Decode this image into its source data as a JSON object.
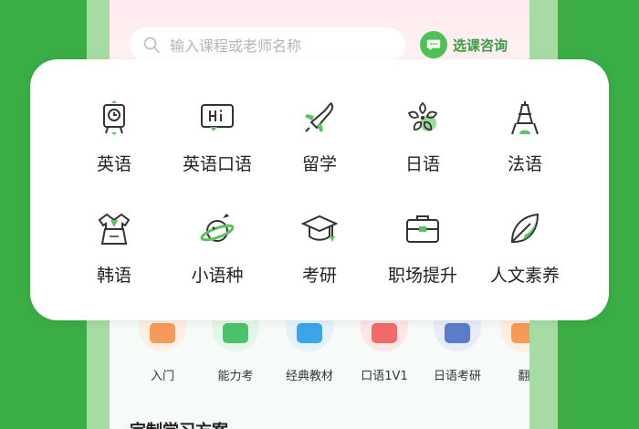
{
  "search": {
    "placeholder": "输入课程或老师名称"
  },
  "consult": {
    "label": "选课咨询"
  },
  "categories": [
    {
      "label": "英语",
      "icon": "alarm-clock-icon"
    },
    {
      "label": "英语口语",
      "icon": "hi-speech-icon"
    },
    {
      "label": "留学",
      "icon": "airplane-icon"
    },
    {
      "label": "日语",
      "icon": "sakura-icon"
    },
    {
      "label": "法语",
      "icon": "eiffel-tower-icon"
    },
    {
      "label": "韩语",
      "icon": "hanbok-icon"
    },
    {
      "label": "小语种",
      "icon": "saturn-icon"
    },
    {
      "label": "考研",
      "icon": "graduation-cap-icon"
    },
    {
      "label": "职场提升",
      "icon": "briefcase-icon"
    },
    {
      "label": "人文素养",
      "icon": "leaf-icon"
    }
  ],
  "sub_items": [
    {
      "label": "入门",
      "color": "#f59a57",
      "bg": "#fdeee4"
    },
    {
      "label": "能力考",
      "color": "#4cc26a",
      "bg": "#e5f6e8"
    },
    {
      "label": "经典教材",
      "color": "#3aa5e8",
      "bg": "#e3f2fc"
    },
    {
      "label": "口语1V1",
      "color": "#f26a6a",
      "bg": "#fde6e6"
    },
    {
      "label": "日语考研",
      "color": "#5b7cc9",
      "bg": "#e7ecf8"
    },
    {
      "label": "翻",
      "color": "#f59a57",
      "bg": "#fdeee4"
    }
  ],
  "section": {
    "title": "定制学习方案"
  },
  "colors": {
    "accent": "#3aae45",
    "icon_green": "#5cc45f",
    "icon_stroke": "#333333"
  }
}
